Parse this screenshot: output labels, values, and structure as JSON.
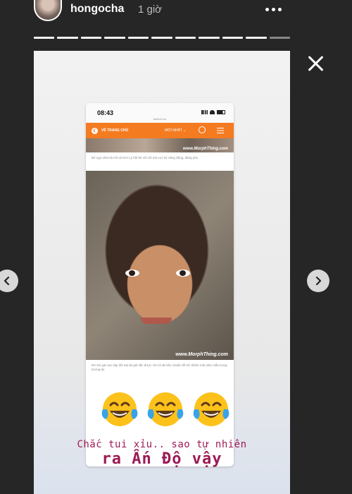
{
  "header": {
    "username": "hongocha",
    "timestamp": "1 giờ",
    "more_icon": "more-horizontal-icon"
  },
  "progress": {
    "segments": 11,
    "current": 10
  },
  "controls": {
    "close_icon": "close-icon",
    "prev_icon": "chevron-left-icon",
    "next_icon": "chevron-right-icon"
  },
  "screenshot": {
    "clock": "08:43",
    "url": "kenh14.vn",
    "home_label": "VỀ TRANG CHỦ",
    "latest_label": "MỚI NHẤT ⌄",
    "watermark": "www.MorphThing.com",
    "caption_top": "Bé ngo nhà Hà Hồ và Kim Lý hồi bé xôi xôi mà cực kỳ năng động, đáng yêu.",
    "caption_bottom": "Em bé giả của cặp đôi trai tài gái sắc được cho là đủ tiêu chuẩn để trở thành một siêu mẫu trong tương lai."
  },
  "story_text": {
    "line1": "Chắc tui xỉu.. sao tự nhiên",
    "line2": "ra Ấn Độ vậy"
  },
  "emojis": [
    "face-with-tears-of-joy",
    "face-with-tears-of-joy",
    "face-with-tears-of-joy"
  ],
  "colors": {
    "accent": "#f47b20",
    "caption_text": "#9c1a55",
    "background": "#262626"
  }
}
